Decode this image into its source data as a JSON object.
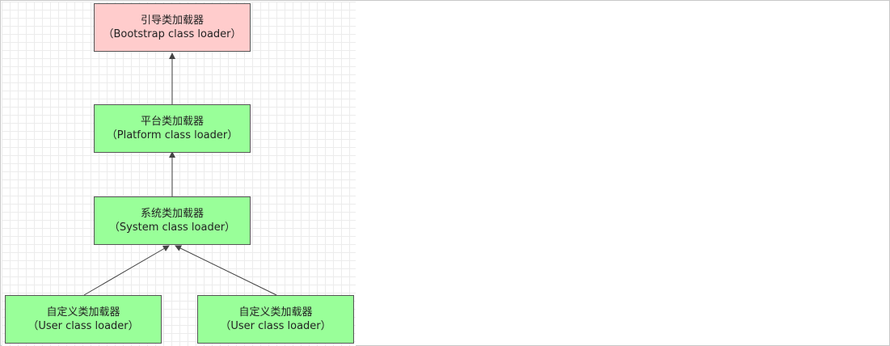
{
  "colors": {
    "bootstrap_fill": "#ffcccc",
    "loader_fill": "#99ff99",
    "border": "#555555",
    "edge": "#444444"
  },
  "nodes": {
    "bootstrap": {
      "cn": "引导类加载器",
      "en": "（Bootstrap class loader）"
    },
    "platform": {
      "cn": "平台类加载器",
      "en": "（Platform class loader）"
    },
    "system": {
      "cn": "系统类加载器",
      "en": "（System class loader）"
    },
    "user_left": {
      "cn": "自定义类加载器",
      "en": "（User class loader）"
    },
    "user_right": {
      "cn": "自定义类加载器",
      "en": "（User class loader）"
    }
  },
  "edges": [
    {
      "from": "platform",
      "to": "bootstrap"
    },
    {
      "from": "system",
      "to": "platform"
    },
    {
      "from": "user_left",
      "to": "system"
    },
    {
      "from": "user_right",
      "to": "system"
    }
  ]
}
